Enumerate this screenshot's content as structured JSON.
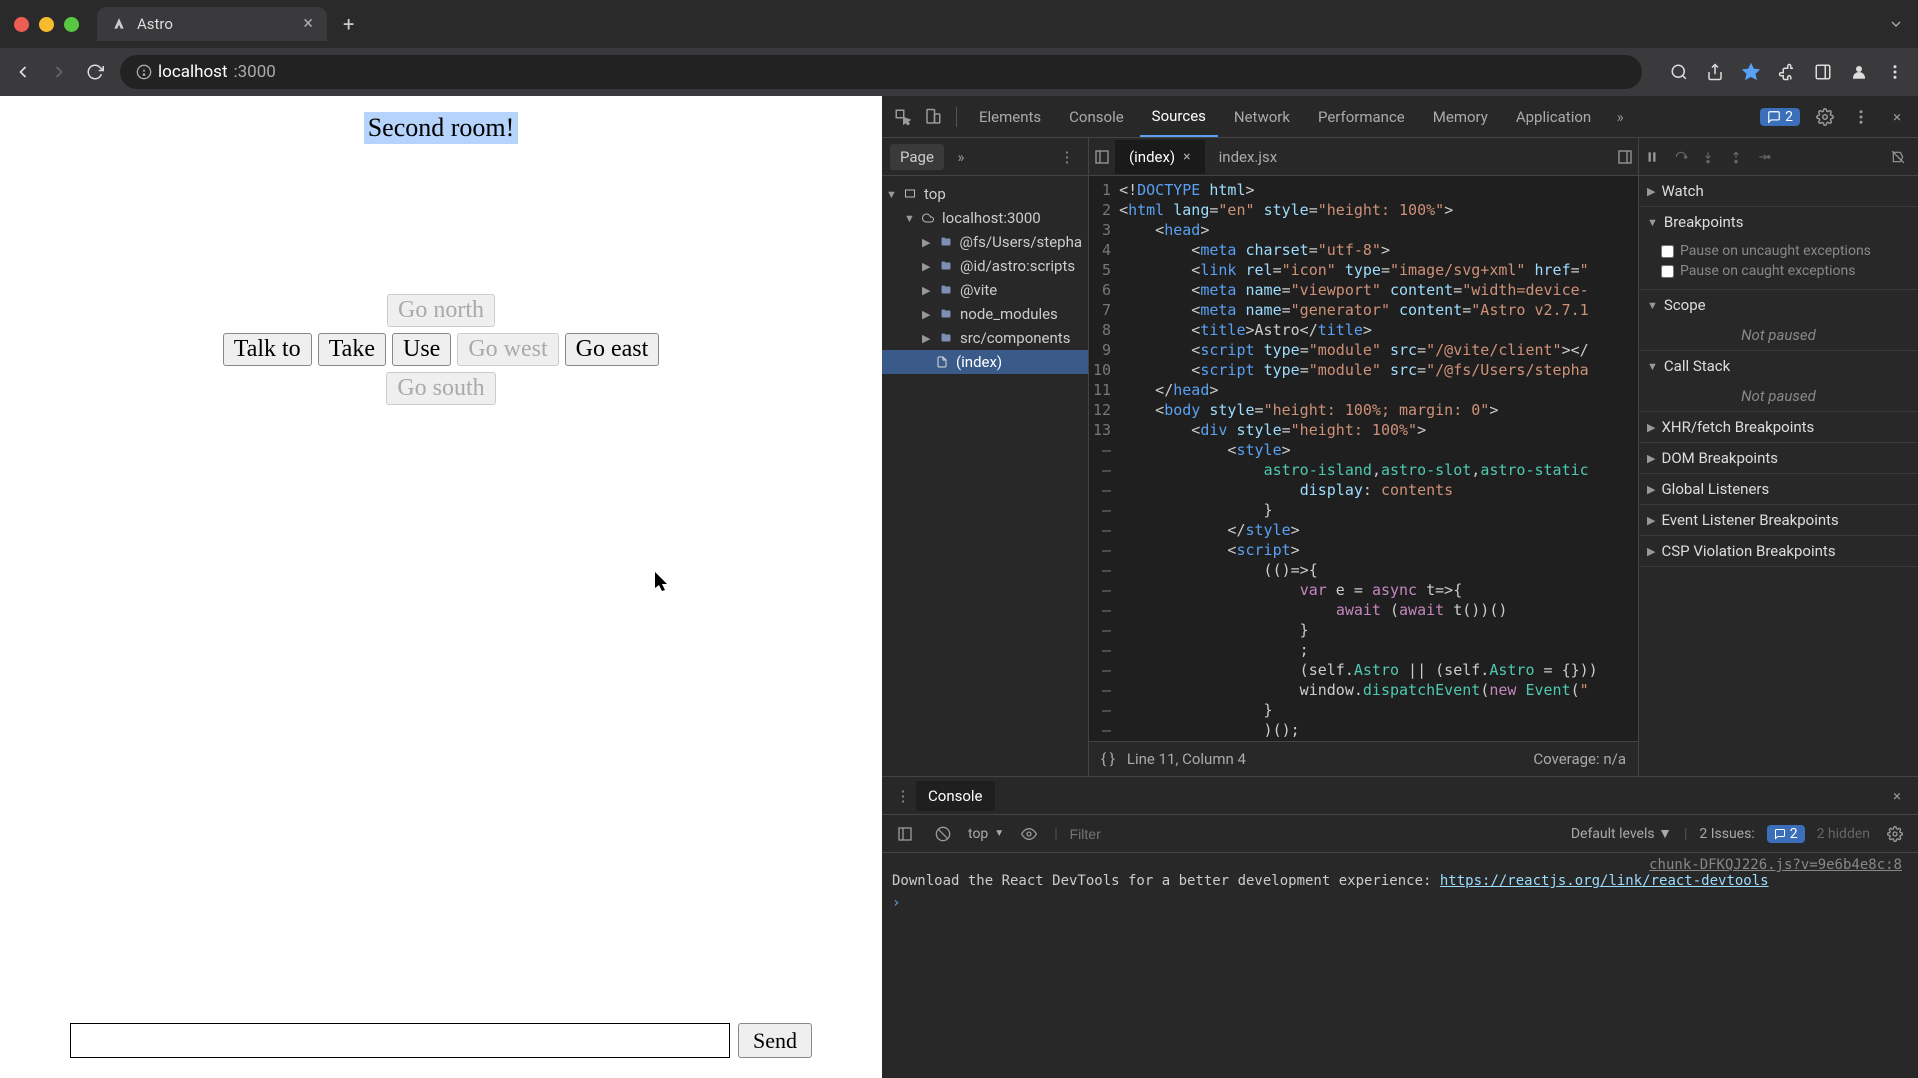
{
  "browser": {
    "tab": {
      "title": "Astro"
    },
    "url_host": "localhost",
    "url_port": ":3000"
  },
  "game": {
    "title": "Second room!",
    "actions": {
      "talk": "Talk to",
      "take": "Take",
      "use": "Use"
    },
    "nav": {
      "north": "Go north",
      "west": "Go west",
      "east": "Go east",
      "south": "Go south"
    },
    "send": "Send"
  },
  "devtools": {
    "tabs": [
      "Elements",
      "Console",
      "Sources",
      "Network",
      "Performance",
      "Memory",
      "Application"
    ],
    "active_tab": "Sources",
    "issue_count": "2",
    "page_label": "Page",
    "tree": {
      "top": "top",
      "host": "localhost:3000",
      "folders": [
        "@fs/Users/stepha",
        "@id/astro:scripts",
        "@vite",
        "node_modules",
        "src/components"
      ],
      "file": "(index)"
    },
    "open_files": [
      "(index)",
      "index.jsx"
    ],
    "active_file": "(index)",
    "gutter": [
      "1",
      "2",
      "3",
      "4",
      "5",
      "6",
      "7",
      "8",
      "9",
      "10",
      "11",
      "12",
      "13",
      "–",
      "–",
      "–",
      "–",
      "–",
      "–",
      "–",
      "–",
      "–",
      "–",
      "–",
      "–",
      "–",
      "–",
      "–",
      "–",
      "–",
      "–"
    ],
    "status": {
      "pos": "Line 11, Column 4",
      "coverage": "Coverage: n/a"
    },
    "panels": {
      "watch": "Watch",
      "breakpoints": "Breakpoints",
      "bp_uncaught": "Pause on uncaught exceptions",
      "bp_caught": "Pause on caught exceptions",
      "scope": "Scope",
      "callstack": "Call Stack",
      "xhr": "XHR/fetch Breakpoints",
      "dom": "DOM Breakpoints",
      "global": "Global Listeners",
      "event": "Event Listener Breakpoints",
      "csp": "CSP Violation Breakpoints",
      "not_paused": "Not paused"
    }
  },
  "console": {
    "title": "Console",
    "ctx": "top",
    "filter_ph": "Filter",
    "levels": "Default levels",
    "issues_lbl": "2 Issues:",
    "issues_n": "2",
    "hidden": "2 hidden",
    "src": "chunk-DFKQJ226.js?v=9e6b4e8c:8",
    "msg_pre": "Download the React DevTools for a better development experience: ",
    "msg_link": "https://reactjs.org/link/react-devtools"
  }
}
